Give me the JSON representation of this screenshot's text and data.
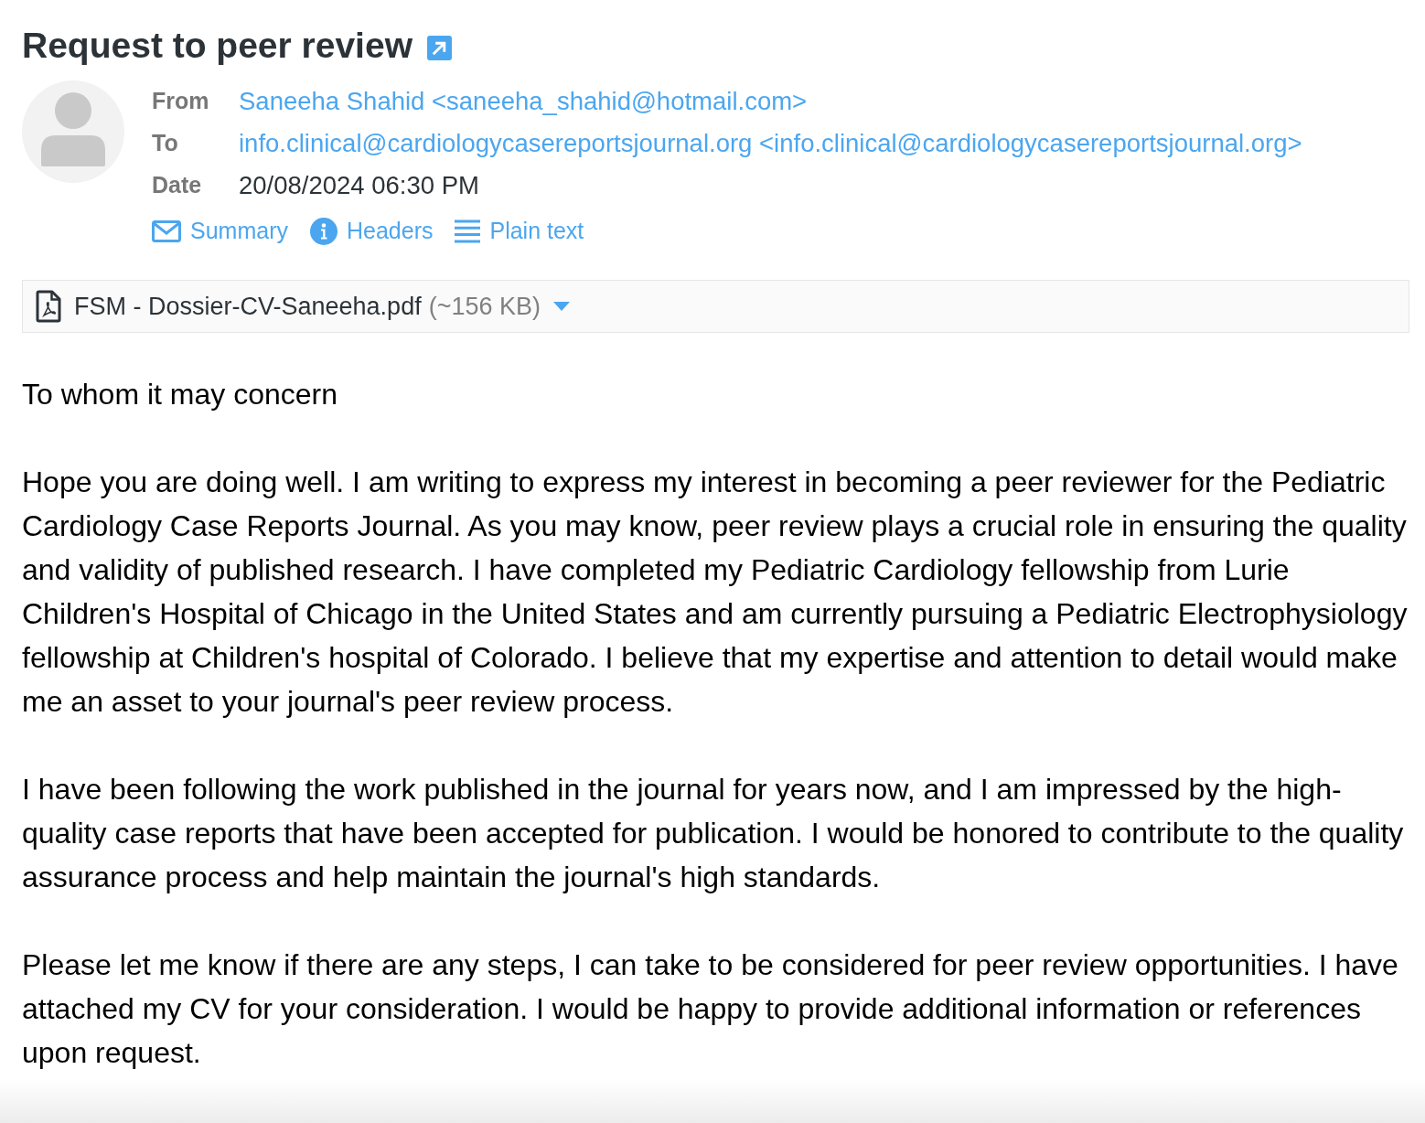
{
  "subject": {
    "title": "Request to peer review"
  },
  "headers": [
    {
      "label": "From",
      "value": "Saneeha Shahid <saneeha_shahid@hotmail.com>",
      "kind": "link"
    },
    {
      "label": "To",
      "value": "info.clinical@cardiologycasereportsjournal.org <info.clinical@cardiologycasereportsjournal.org>",
      "kind": "link"
    },
    {
      "label": "Date",
      "value": "20/08/2024 06:30 PM",
      "kind": "text"
    }
  ],
  "view_links": [
    {
      "label": "Summary",
      "kind": "envelope"
    },
    {
      "label": "Headers",
      "kind": "info"
    },
    {
      "label": "Plain text",
      "kind": "lines"
    }
  ],
  "attachment": {
    "filename": "FSM - Dossier-CV-Saneeha.pdf",
    "size": "(~156 KB)"
  },
  "body": {
    "paragraphs": [
      "To whom it may concern",
      "Hope you are doing well. I am writing to express my interest in becoming a peer reviewer for the Pediatric Cardiology Case Reports Journal. As you may know, peer review plays a crucial role in ensuring the quality and validity of published research. I have completed my Pediatric Cardiology fellowship from Lurie Children's Hospital of Chicago in the United States and am currently pursuing a Pediatric Electrophysiology fellowship at Children's hospital of Colorado. I believe that my expertise and attention to detail would make me an asset to your journal's peer review process.",
      "I have been following the work published in the journal for years now, and I am impressed by the high-quality case reports that have been accepted for publication. I would be honored to contribute to the quality assurance process and help maintain the journal's high standards.",
      "Please let me know if there are any steps, I can take to be considered for peer review opportunities. I have attached my CV for your consideration. I would be happy to provide additional information or references upon request."
    ]
  }
}
